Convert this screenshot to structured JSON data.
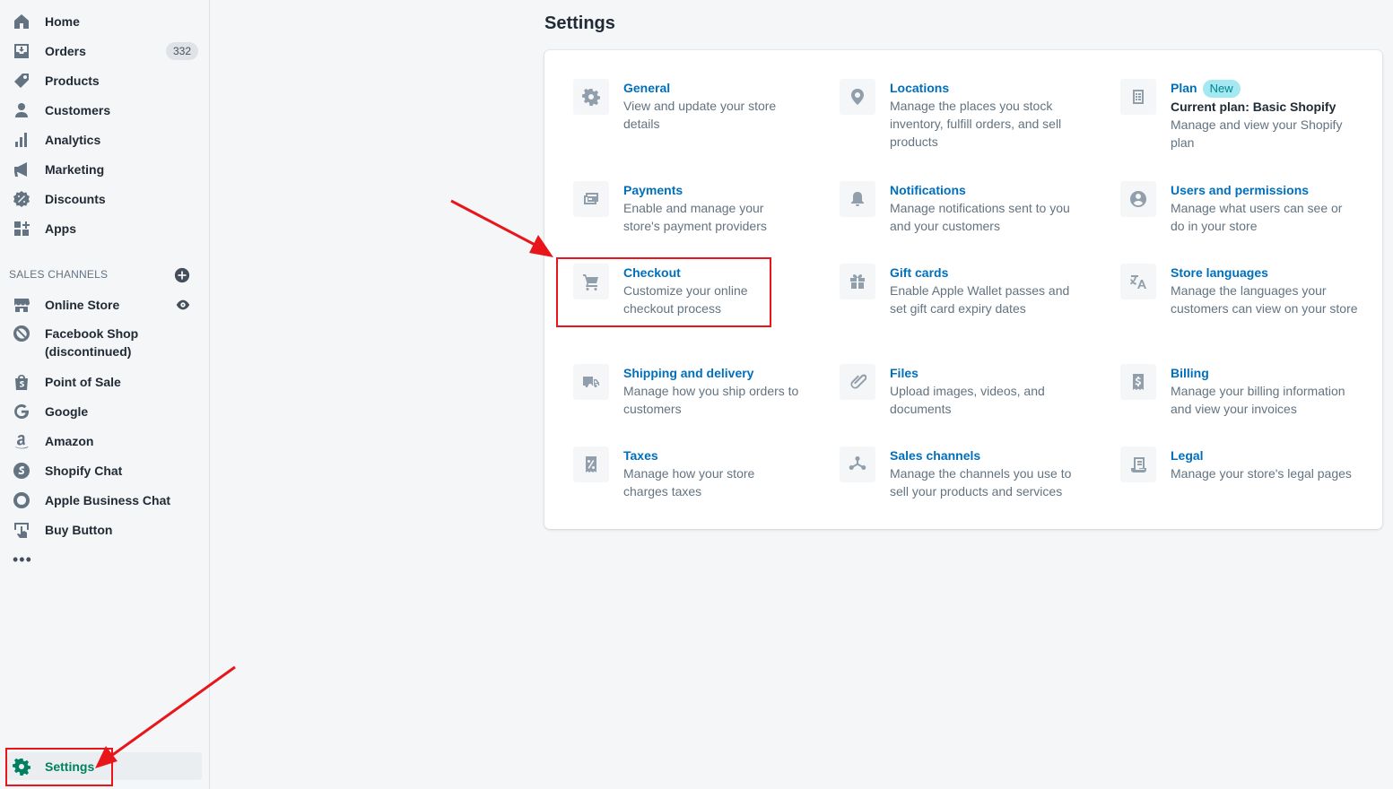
{
  "sidebar": {
    "items": [
      {
        "label": "Home",
        "icon": "home-icon"
      },
      {
        "label": "Orders",
        "icon": "orders-icon",
        "badge": "332"
      },
      {
        "label": "Products",
        "icon": "tag-icon"
      },
      {
        "label": "Customers",
        "icon": "person-icon"
      },
      {
        "label": "Analytics",
        "icon": "bar-chart-icon"
      },
      {
        "label": "Marketing",
        "icon": "megaphone-icon"
      },
      {
        "label": "Discounts",
        "icon": "discount-icon"
      },
      {
        "label": "Apps",
        "icon": "apps-icon"
      }
    ],
    "sales_channels_heading": "SALES CHANNELS",
    "channels": [
      {
        "label": "Online Store",
        "icon": "store-icon"
      },
      {
        "label": "Facebook Shop",
        "label2": "(discontinued)",
        "icon": "blocked-icon"
      },
      {
        "label": "Point of Sale",
        "icon": "shopify-bag-icon"
      },
      {
        "label": "Google",
        "icon": "google-icon"
      },
      {
        "label": "Amazon",
        "icon": "amazon-icon"
      },
      {
        "label": "Shopify Chat",
        "icon": "shopify-chat-icon"
      },
      {
        "label": "Apple Business Chat",
        "icon": "chat-bubble-icon"
      },
      {
        "label": "Buy Button",
        "icon": "buy-button-icon"
      }
    ],
    "more": "•••",
    "settings_label": "Settings"
  },
  "main": {
    "title": "Settings",
    "settings": [
      {
        "title": "General",
        "desc": "View and update your store details",
        "icon": "gear-icon"
      },
      {
        "title": "Locations",
        "desc": "Manage the places you stock inventory, fulfill orders, and sell products",
        "icon": "location-pin-icon"
      },
      {
        "title": "Plan",
        "badge": "New",
        "subtitle": "Current plan: Basic Shopify",
        "desc": "Manage and view your Shopify plan",
        "icon": "plan-icon"
      },
      {
        "title": "Payments",
        "desc": "Enable and manage your store's payment providers",
        "icon": "payments-icon"
      },
      {
        "title": "Notifications",
        "desc": "Manage notifications sent to you and your customers",
        "icon": "bell-icon"
      },
      {
        "title": "Users and permissions",
        "desc": "Manage what users can see or do in your store",
        "icon": "user-circle-icon"
      },
      {
        "title": "Checkout",
        "desc": "Customize your online checkout process",
        "icon": "cart-icon"
      },
      {
        "title": "Gift cards",
        "desc": "Enable Apple Wallet passes and set gift card expiry dates",
        "icon": "gift-icon"
      },
      {
        "title": "Store languages",
        "desc": "Manage the languages your customers can view on your store",
        "icon": "translate-icon"
      },
      {
        "title": "Shipping and delivery",
        "desc": "Manage how you ship orders to customers",
        "icon": "truck-icon"
      },
      {
        "title": "Files",
        "desc": "Upload images, videos, and documents",
        "icon": "paperclip-icon"
      },
      {
        "title": "Billing",
        "desc": "Manage your billing information and view your invoices",
        "icon": "billing-icon"
      },
      {
        "title": "Taxes",
        "desc": "Manage how your store charges taxes",
        "icon": "tax-icon"
      },
      {
        "title": "Sales channels",
        "desc": "Manage the channels you use to sell your products and services",
        "icon": "channels-icon"
      },
      {
        "title": "Legal",
        "desc": "Manage your store's legal pages",
        "icon": "legal-icon"
      }
    ]
  },
  "annotations": {
    "highlight_color": "#e8161b"
  }
}
